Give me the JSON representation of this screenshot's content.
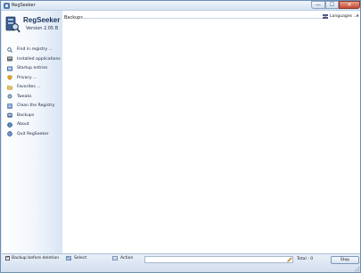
{
  "window": {
    "title": "RegSeeker",
    "minimize_glyph": "—",
    "maximize_glyph": "☐",
    "close_glyph": "✕"
  },
  "sidebar": {
    "brand": "RegSeeker",
    "version": "Version 2.05 B",
    "items": [
      {
        "label": "Find in registry ...",
        "icon": "magnifier-icon"
      },
      {
        "label": "Installed applications",
        "icon": "applications-icon"
      },
      {
        "label": "Startup entries",
        "icon": "startup-icon"
      },
      {
        "label": "Privacy ...",
        "icon": "privacy-icon"
      },
      {
        "label": "Favorites ...",
        "icon": "favorites-icon"
      },
      {
        "label": "Tweaks",
        "icon": "tweaks-icon"
      },
      {
        "label": "Clean the Registry",
        "icon": "clean-icon"
      },
      {
        "label": "Backups",
        "icon": "backups-icon"
      },
      {
        "label": "About",
        "icon": "about-icon"
      },
      {
        "label": "Quit RegSeeker",
        "icon": "quit-icon"
      }
    ]
  },
  "main": {
    "breadcrumb": "Backups",
    "languages_label": "Languages ..."
  },
  "bottom": {
    "backup_checkbox_label": "Backup before deletion",
    "backup_checked": true,
    "select_label": "Select",
    "action_label": "Action",
    "field_value": "",
    "total_label": "Total : 0",
    "stop_label": "Stop"
  },
  "colors": {
    "accent": "#16305a",
    "close_button": "#c74a32",
    "panel_bg": "#dbe6f3"
  }
}
